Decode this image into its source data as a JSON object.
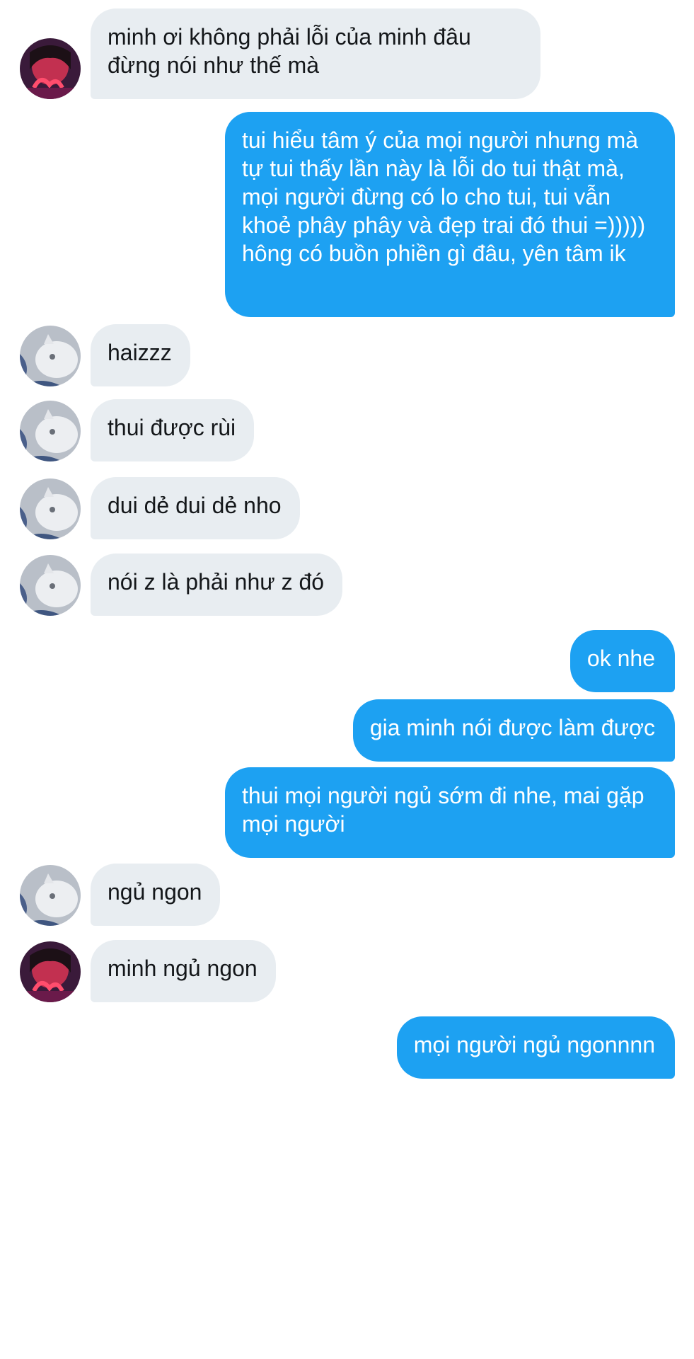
{
  "conversation": {
    "messages": [
      {
        "sender": "in",
        "avatar": "girl-avatar",
        "text": "minh ơi không phải lỗi của minh đâu\nđừng nói như thế mà"
      },
      {
        "sender": "out",
        "text": "tui hiểu tâm ý của mọi người nhưng mà tự tui thấy lần này là lỗi do tui thật mà, mọi người đừng có lo cho tui, tui vẫn khoẻ phây phây và đẹp trai đó thui =))))) hông có buồn phiền gì đâu, yên tâm ik"
      },
      {
        "sender": "in",
        "avatar": "cat-avatar",
        "text": "haizzz"
      },
      {
        "sender": "in",
        "avatar": "cat-avatar",
        "text": "thui được rùi"
      },
      {
        "sender": "in",
        "avatar": "cat-avatar",
        "text": "dui dẻ dui dẻ nho"
      },
      {
        "sender": "in",
        "avatar": "cat-avatar",
        "text": "nói z là phải như z đó"
      },
      {
        "sender": "out",
        "text": "ok nhe"
      },
      {
        "sender": "out",
        "text": "gia minh nói được làm được"
      },
      {
        "sender": "out",
        "text": "thui mọi người ngủ sớm đi nhe, mai gặp mọi người"
      },
      {
        "sender": "in",
        "avatar": "cat-avatar",
        "text": "ngủ ngon"
      },
      {
        "sender": "in",
        "avatar": "girl-avatar",
        "text": "minh ngủ ngon"
      },
      {
        "sender": "out",
        "text": "mọi người ngủ ngonnnn"
      }
    ]
  },
  "colors": {
    "incoming_bubble": "#e8edf1",
    "outgoing_bubble": "#1da1f2",
    "incoming_text": "#14171a",
    "outgoing_text": "#ffffff"
  }
}
